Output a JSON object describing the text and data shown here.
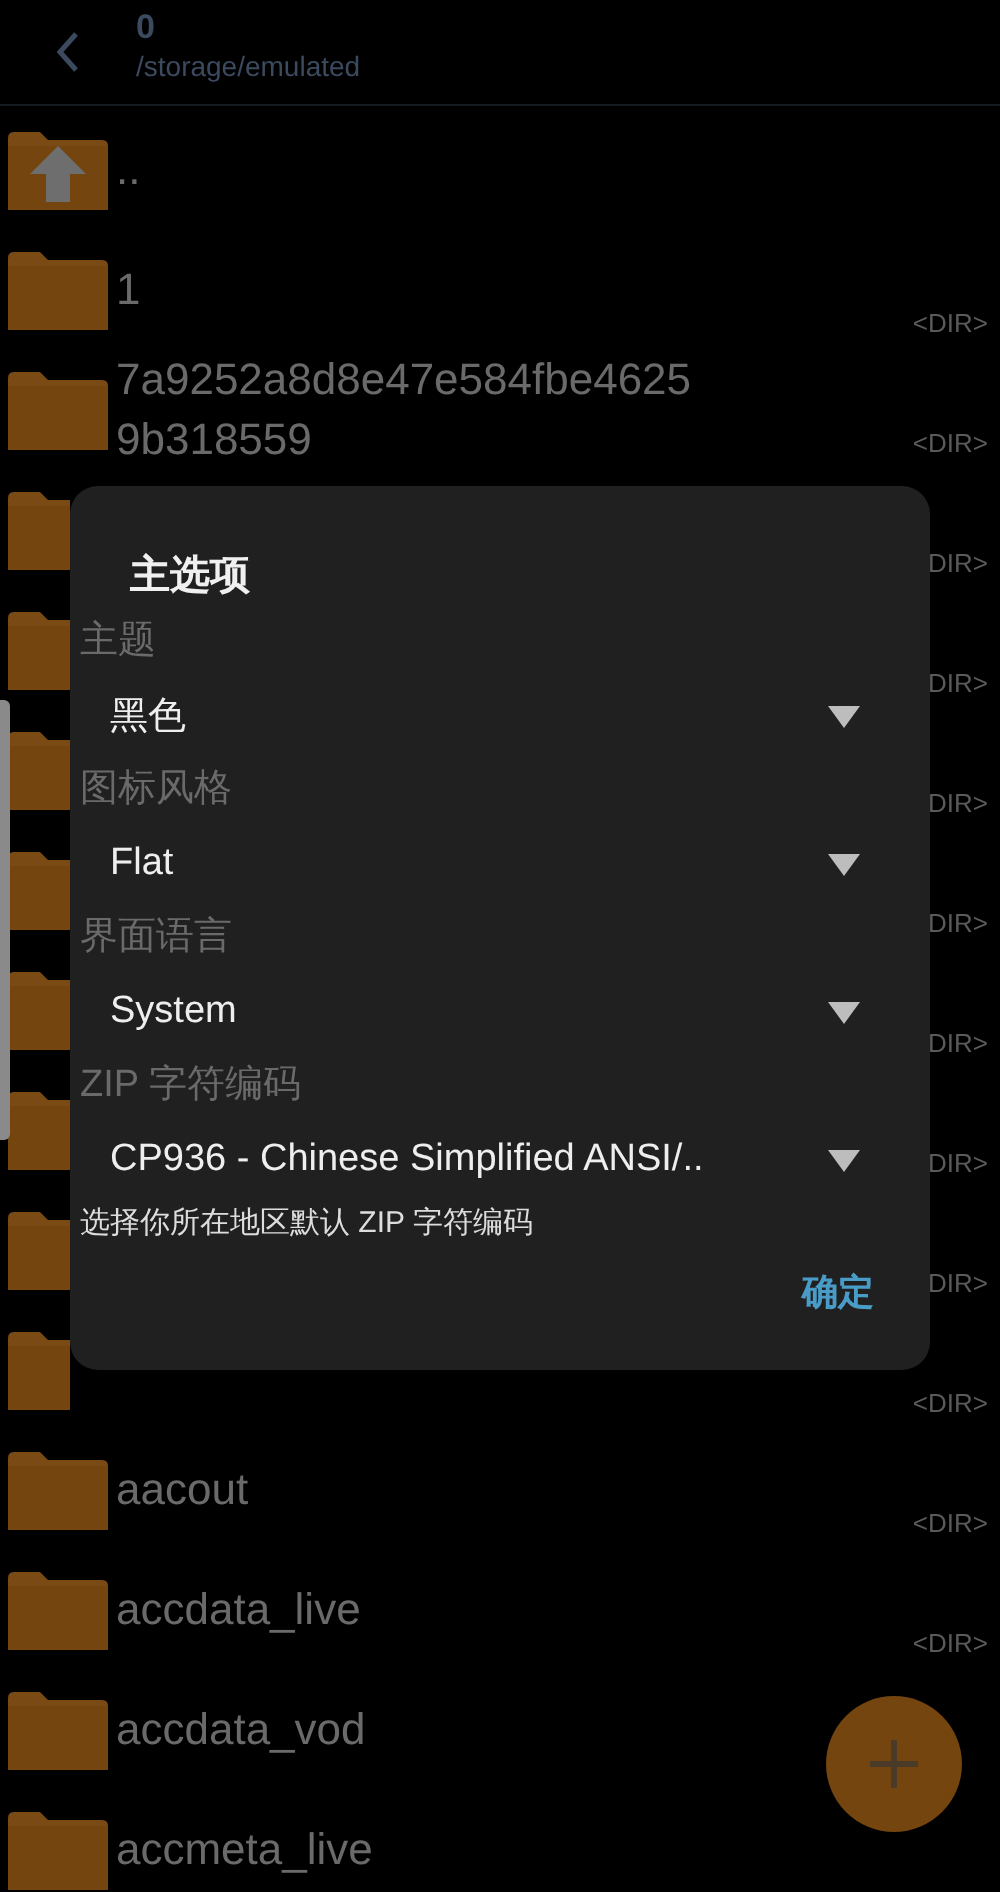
{
  "header": {
    "title": "0",
    "path": "/storage/emulated"
  },
  "files": [
    {
      "kind": "up",
      "name": ".."
    },
    {
      "kind": "folder",
      "name": "1",
      "tag": "<DIR>"
    },
    {
      "kind": "folder",
      "name": "7a9252a8d8e47e584fbe46259b318559",
      "tag": "<DIR>"
    },
    {
      "kind": "folder",
      "tag": "DIR>"
    },
    {
      "kind": "folder",
      "tag": "DIR>"
    },
    {
      "kind": "folder",
      "tag": "DIR>"
    },
    {
      "kind": "folder",
      "tag": "DIR>"
    },
    {
      "kind": "folder",
      "tag": "DIR>"
    },
    {
      "kind": "folder",
      "tag": "DIR>"
    },
    {
      "kind": "folder",
      "tag": "DIR>"
    },
    {
      "kind": "folder",
      "tag": "<DIR>"
    },
    {
      "kind": "folder",
      "name": "aacout",
      "tag": "<DIR>"
    },
    {
      "kind": "folder",
      "name": "accdata_live",
      "tag": "<DIR>"
    },
    {
      "kind": "folder",
      "name": "accdata_vod"
    },
    {
      "kind": "folder",
      "name": "accmeta_live"
    }
  ],
  "dialog": {
    "title": "主选项",
    "settings": [
      {
        "label": "主题",
        "value": "黑色"
      },
      {
        "label": "图标风格",
        "value": "Flat"
      },
      {
        "label": "界面语言",
        "value": "System"
      },
      {
        "label": "ZIP 字符编码",
        "value": "CP936 - Chinese Simplified ANSI/.."
      }
    ],
    "hint": "选择你所在地区默认 ZIP 字符编码",
    "button": "确定"
  }
}
